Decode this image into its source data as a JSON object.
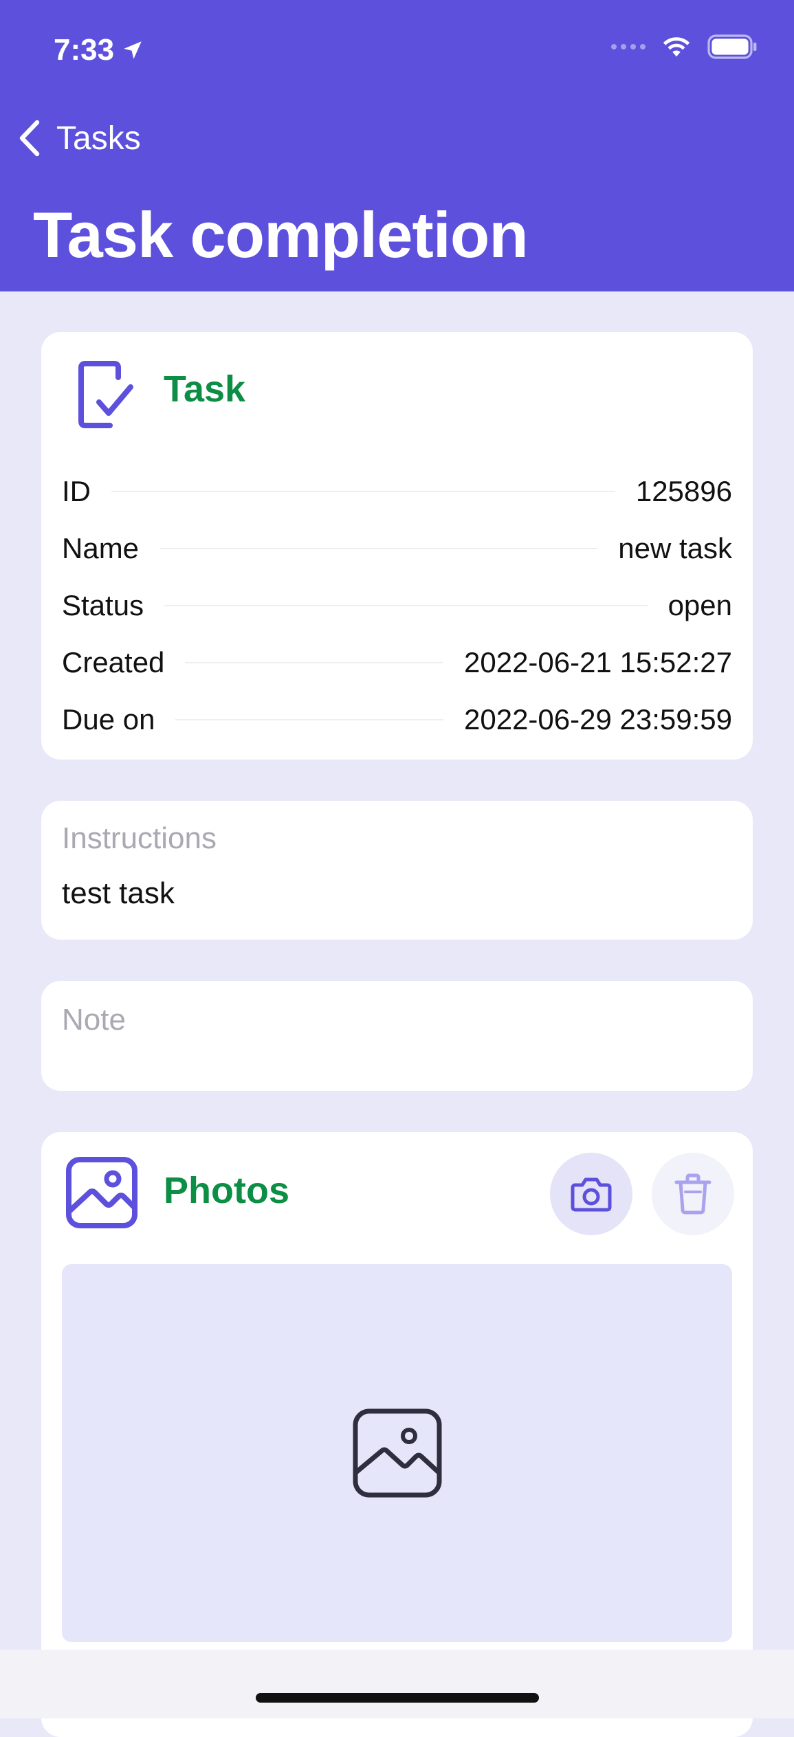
{
  "status_bar": {
    "time": "7:33"
  },
  "nav": {
    "back_label": "Tasks",
    "title": "Task completion"
  },
  "task_card": {
    "title": "Task",
    "rows": [
      {
        "label": "ID",
        "value": "125896"
      },
      {
        "label": "Name",
        "value": "new task"
      },
      {
        "label": "Status",
        "value": "open"
      },
      {
        "label": "Created",
        "value": "2022-06-21 15:52:27"
      },
      {
        "label": "Due on",
        "value": "2022-06-29 23:59:59"
      }
    ]
  },
  "instructions": {
    "label": "Instructions",
    "value": "test task"
  },
  "note": {
    "placeholder": "Note"
  },
  "photos": {
    "title": "Photos"
  },
  "colors": {
    "header": "#5C50DC",
    "background": "#E8E8F9",
    "section_title": "#0C8E45",
    "accent_icon": "#5C50DC"
  },
  "icons": {
    "status_location": "location-arrow-icon",
    "wifi": "wifi-icon",
    "battery": "battery-icon",
    "back": "chevron-left-icon",
    "task": "task-check-icon",
    "photos": "image-icon",
    "camera": "camera-icon",
    "trash": "trash-icon",
    "placeholder": "image-placeholder-icon"
  }
}
